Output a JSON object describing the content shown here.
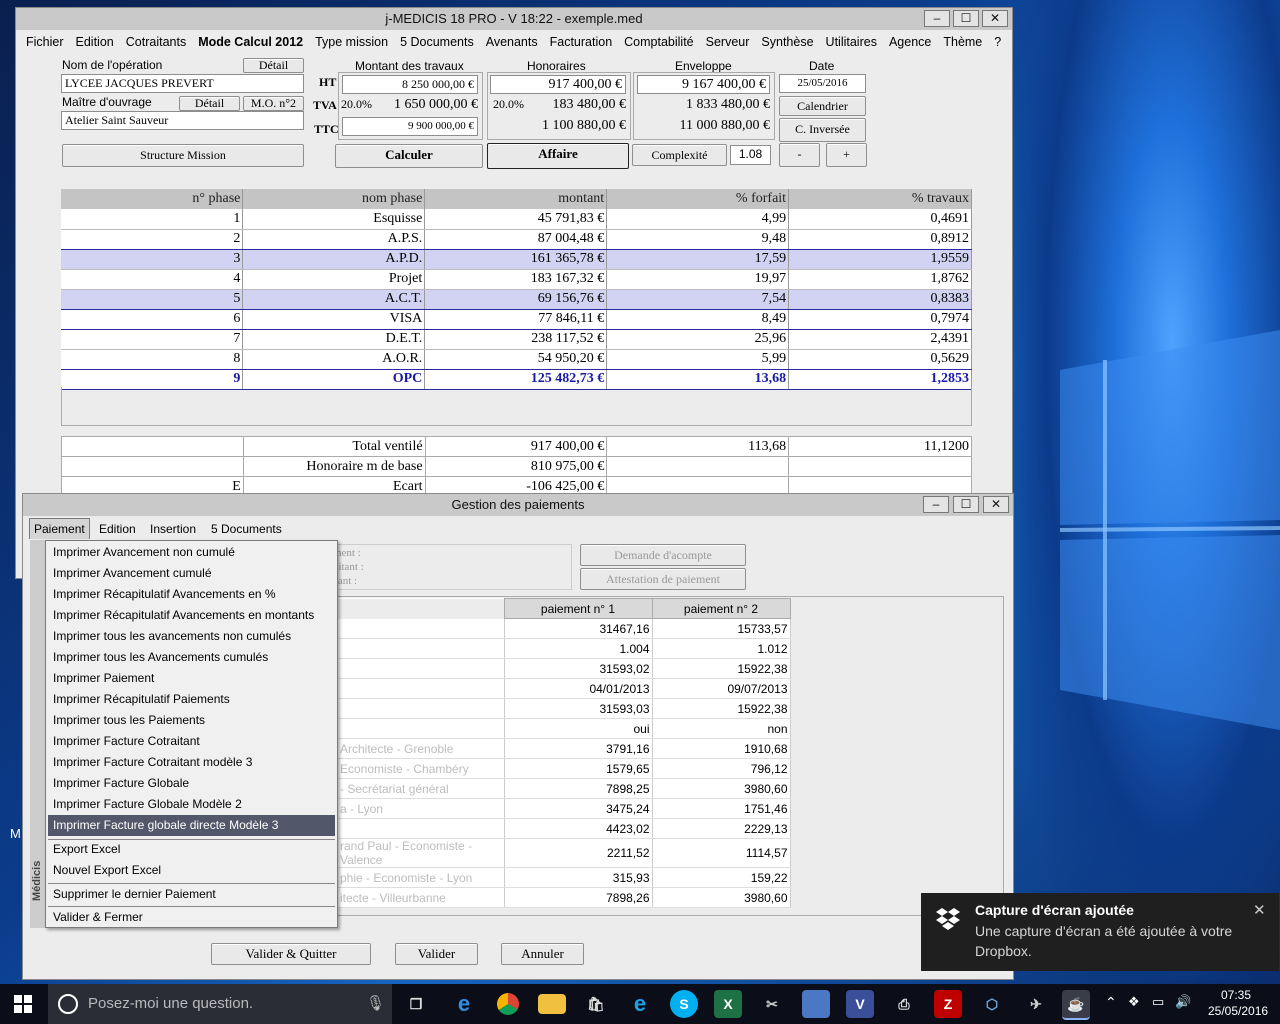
{
  "main_window": {
    "title": "j-MEDICIS 18 PRO - V 18:22 - exemple.med",
    "menu": [
      "Fichier",
      "Edition",
      "Cotraitants",
      "Mode Calcul 2012",
      "Type mission",
      "5 Documents",
      "Avenants",
      "Facturation",
      "Comptabilité",
      "Serveur",
      "Synthèse",
      "Utilitaires",
      "Agence",
      "Thème",
      "?"
    ],
    "nom_operation_label": "Nom de l'opération",
    "detail_label": "Détail",
    "nom_operation_value": "LYCEE JACQUES PREVERT",
    "maitre_ouvrage_label": "Maître d'ouvrage",
    "mo_button_label": "M.O. n°2",
    "maitre_ouvrage_value": "Atelier Saint Sauveur",
    "structure_mission_label": "Structure Mission",
    "montant_travaux_header": "Montant des travaux",
    "honoraires_header": "Honoraires",
    "enveloppe_header": "Enveloppe",
    "date_header": "Date",
    "ht_label": "HT",
    "tva_label": "TVA",
    "ttc_label": "TTC",
    "tva_rate": "20.0%",
    "tva_rate_hon": "20.0%",
    "travaux_ht": "8 250 000,00 €",
    "travaux_tva": "1 650 000,00 €",
    "travaux_ttc": "9 900 000,00 €",
    "hon_ht": "917 400,00 €",
    "hon_tva": "183 480,00 €",
    "hon_ttc": "1 100 880,00 €",
    "env_ht": "9 167 400,00 €",
    "env_tva": "1 833 480,00 €",
    "env_ttc": "11 000 880,00 €",
    "date_value": "25/05/2016",
    "calendrier_label": "Calendrier",
    "c_inversee_label": "C. Inversée",
    "calculer_label": "Calculer",
    "affaire_label": "Affaire",
    "complexite_label": "Complexité",
    "complexite_value": "1.08",
    "minus_label": "-",
    "plus_label": "+",
    "phase_columns": [
      "n° phase",
      "nom phase",
      "montant",
      "% forfait",
      "% travaux"
    ],
    "phases": [
      {
        "n": "1",
        "nom": "Esquisse",
        "montant": "45 791,83 €",
        "forfait": "4,99",
        "travaux": "0,4691"
      },
      {
        "n": "2",
        "nom": "A.P.S.",
        "montant": "87 004,48 €",
        "forfait": "9,48",
        "travaux": "0,8912"
      },
      {
        "n": "3",
        "nom": "A.P.D.",
        "montant": "161 365,78 €",
        "forfait": "17,59",
        "travaux": "1,9559"
      },
      {
        "n": "4",
        "nom": "Projet",
        "montant": "183 167,32 €",
        "forfait": "19,97",
        "travaux": "1,8762"
      },
      {
        "n": "5",
        "nom": "A.C.T.",
        "montant": "69 156,76 €",
        "forfait": "7,54",
        "travaux": "0,8383"
      },
      {
        "n": "6",
        "nom": "VISA",
        "montant": "77 846,11 €",
        "forfait": "8,49",
        "travaux": "0,7974"
      },
      {
        "n": "7",
        "nom": "D.E.T.",
        "montant": "238 117,52 €",
        "forfait": "25,96",
        "travaux": "2,4391"
      },
      {
        "n": "8",
        "nom": "A.O.R.",
        "montant": "54 950,20 €",
        "forfait": "5,99",
        "travaux": "0,5629"
      },
      {
        "n": "9",
        "nom": "OPC",
        "montant": "125 482,73 €",
        "forfait": "13,68",
        "travaux": "1,2853"
      }
    ],
    "total_ventile_label": "Total ventilé",
    "total_ventile_montant": "917 400,00 €",
    "total_ventile_forfait": "113,68",
    "total_ventile_travaux": "11,1200",
    "honoraire_base_label": "Honoraire m de base",
    "honoraire_base_montant": "810 975,00 €",
    "ecart_prefix": "E",
    "ecart_label": "Ecart",
    "ecart_montant": "-106 425,00 €"
  },
  "payment_window": {
    "title": "Gestion des paiements",
    "menu": [
      "Paiement",
      "Edition",
      "Insertion",
      "5 Documents"
    ],
    "paiement_label": "Paiement :",
    "cotraitant_label": "Cotraitant :",
    "montant_label": "Montant :",
    "demande_acompte_label": "Demande d'acompte",
    "attestation_label": "Attestation de paiement",
    "columns": [
      "paiement n° 1",
      "paiement n° 2"
    ],
    "rows": [
      [
        "31467,16",
        "15733,57"
      ],
      [
        "1.004",
        "1.012"
      ],
      [
        "31593,02",
        "15922,38"
      ],
      [
        "04/01/2013",
        "09/07/2013"
      ],
      [
        "31593,03",
        "15922,38"
      ],
      [
        "oui",
        "non"
      ],
      [
        "3791,16",
        "1910,68"
      ],
      [
        "1579,65",
        "796,12"
      ],
      [
        "7898,25",
        "3980,60"
      ],
      [
        "3475,24",
        "1751,46"
      ],
      [
        "4423,02",
        "2229,13"
      ],
      [
        "2211,52",
        "1114,57"
      ],
      [
        "315,93",
        "159,22"
      ],
      [
        "7898,26",
        "3980,60"
      ]
    ],
    "ghost_texts": [
      "Architecte - Grenoble",
      "Economiste - Chambéry",
      "- Secrétariat général",
      "a - Lyon",
      "rand Paul - Economiste - Valence",
      "phie - Economiste - Lyon",
      "itecte - Villeurbanne"
    ],
    "valider_quitter_label": "Valider & Quitter",
    "valider_label": "Valider",
    "annuler_label": "Annuler",
    "side_label": "Médicis",
    "dropdown": [
      "Imprimer Avancement non cumulé",
      "Imprimer Avancement cumulé",
      "Imprimer Récapitulatif Avancements en %",
      "Imprimer Récapitulatif Avancements en montants",
      "Imprimer tous les avancements non cumulés",
      "Imprimer tous les Avancements cumulés",
      "Imprimer Paiement",
      "Imprimer Récapitulatif Paiements",
      "Imprimer tous les Paiements",
      "Imprimer Facture Cotraitant",
      "Imprimer Facture Cotraitant modèle 3",
      "Imprimer Facture Globale",
      "Imprimer Facture Globale Modèle 2",
      "Imprimer Facture globale directe Modèle 3",
      "Export Excel",
      "Nouvel Export Excel",
      "Supprimer le dernier Paiement",
      "Valider & Fermer"
    ]
  },
  "desktop": {
    "stray_letter": "M"
  },
  "toast": {
    "title": "Capture d'écran ajoutée",
    "body": "Une capture d'écran a été ajoutée à votre Dropbox."
  },
  "taskbar": {
    "search_placeholder": "Posez-moi une question.",
    "time": "07:35",
    "date": "25/05/2016"
  },
  "colors": {
    "selected_row": "#d2d2f2",
    "opc_text": "#1a1aa6",
    "menu_highlight": "#52576a"
  }
}
